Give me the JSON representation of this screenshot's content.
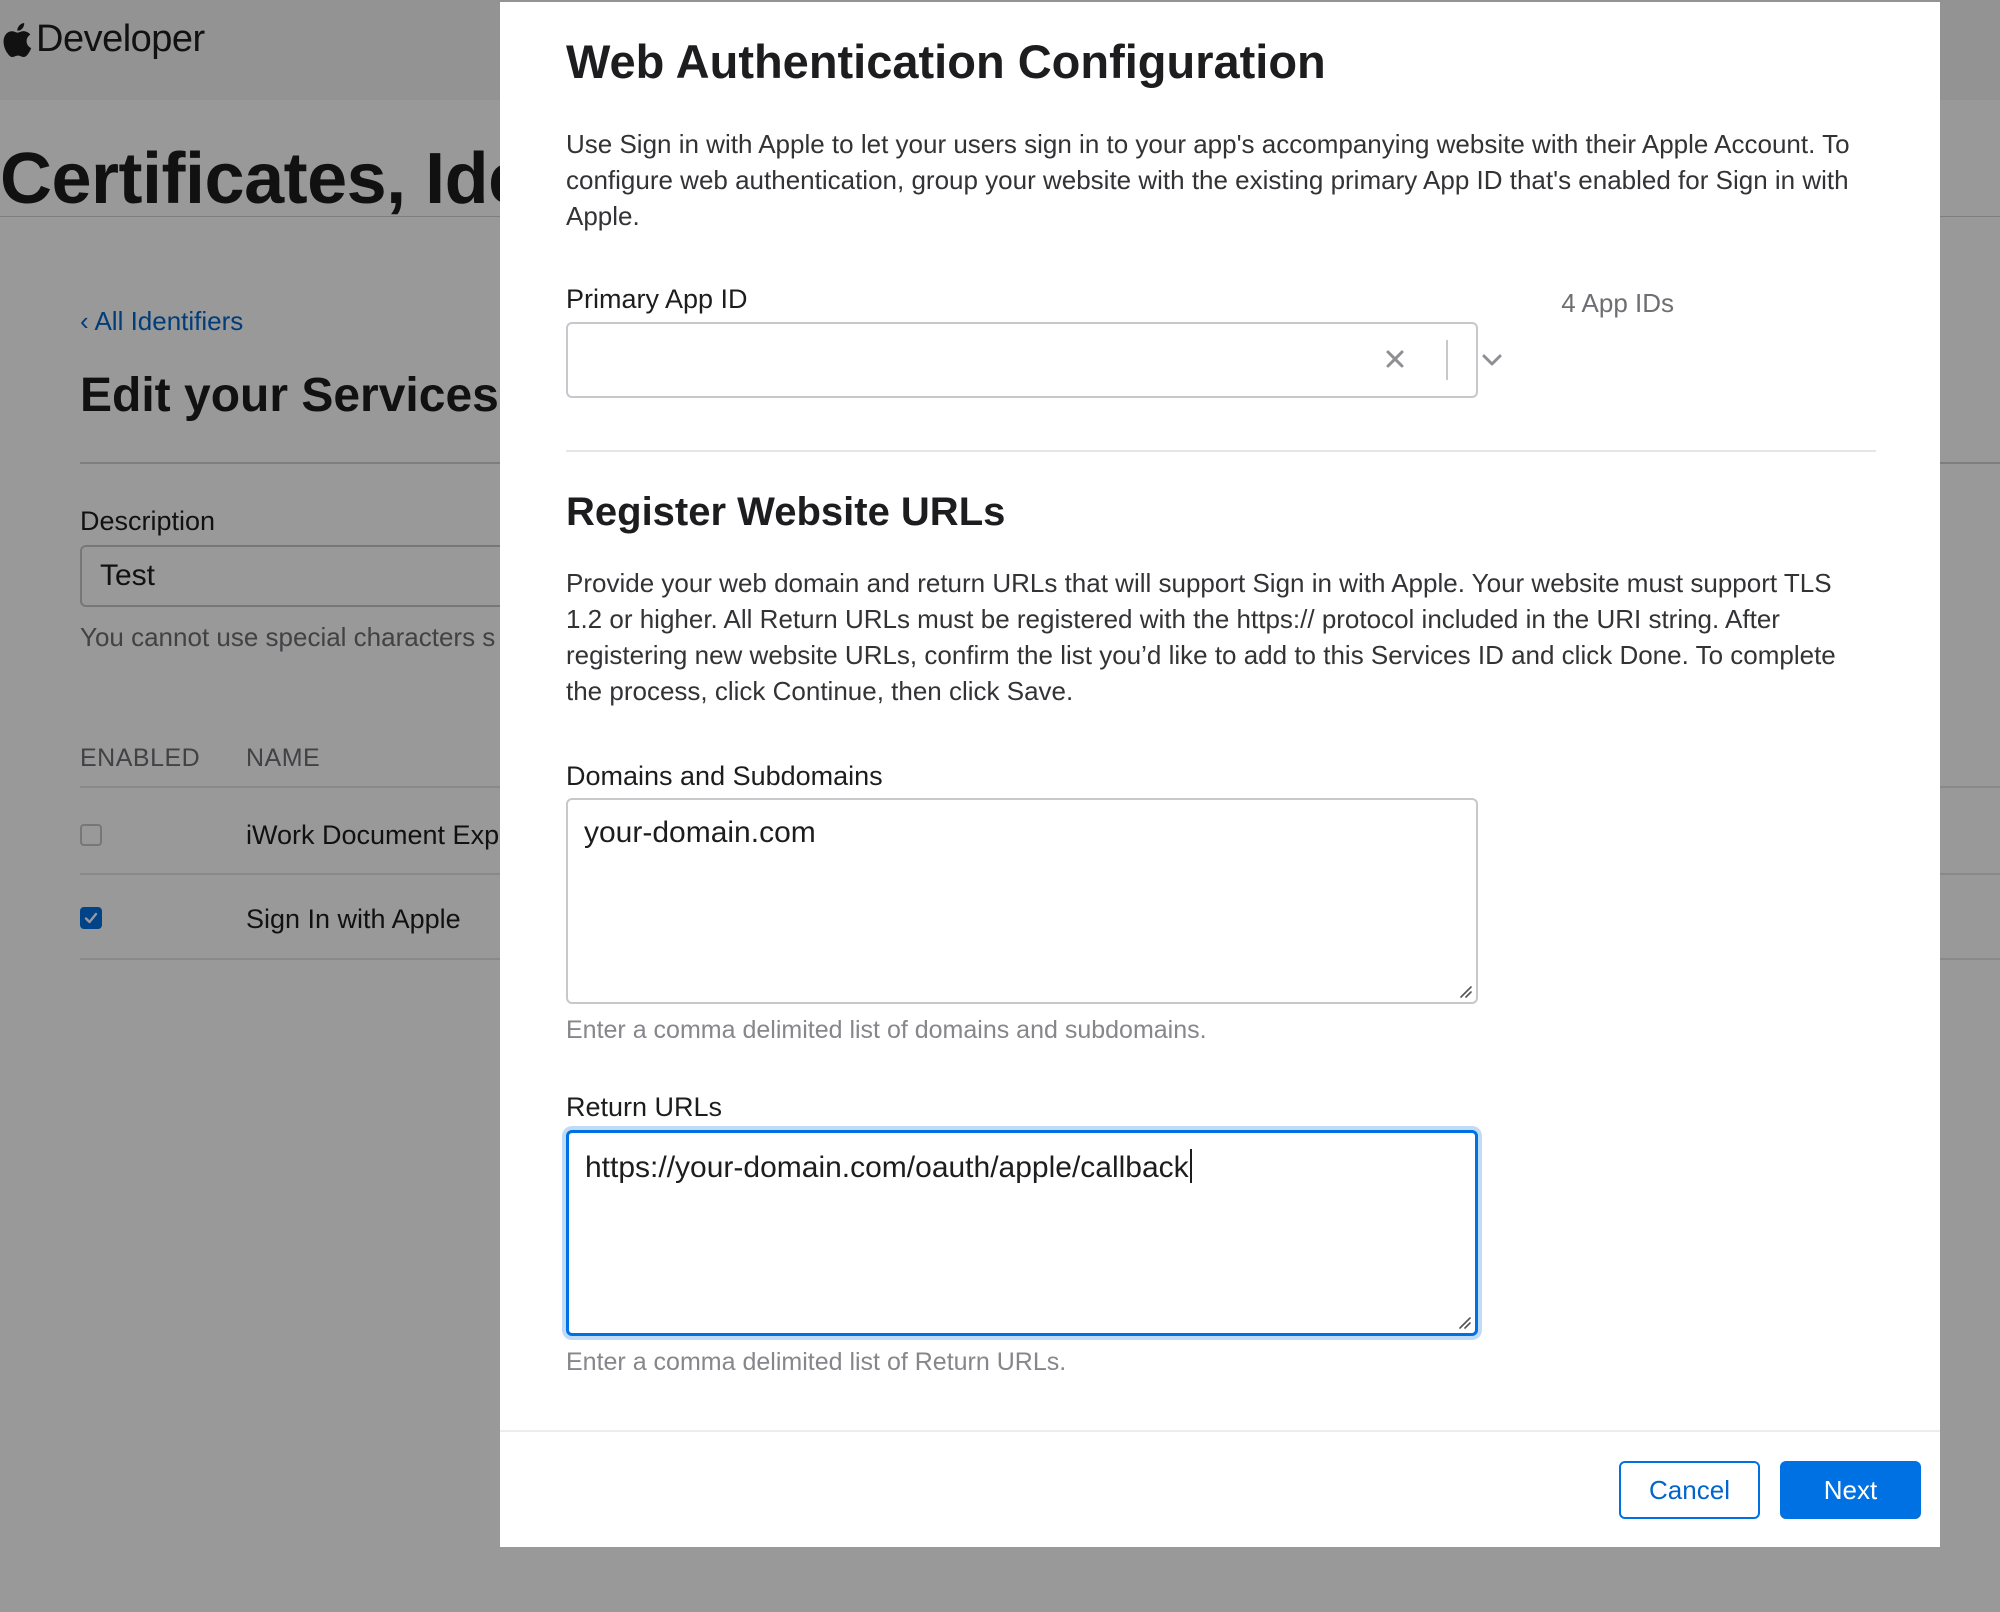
{
  "background": {
    "brand": "Developer",
    "hero_title": "Certificates, Ide",
    "back_link": "‹ All Identifiers",
    "edit_title": "Edit your Services",
    "description_label": "Description",
    "description_value": "Test",
    "description_help": "You cannot use special characters s",
    "table": {
      "headers": [
        "ENABLED",
        "NAME"
      ],
      "rows": [
        {
          "name": "iWork Document Exp",
          "checked": false
        },
        {
          "name": "Sign In with Apple",
          "checked": true
        }
      ]
    }
  },
  "modal": {
    "title": "Web Authentication Configuration",
    "intro": "Use Sign in with Apple to let your users sign in to your app's accompanying website with their Apple Account. To configure web authentication, group your website with the existing primary App ID that's enabled for Sign in with Apple.",
    "primary_app_id": {
      "label": "Primary App ID",
      "count": "4 App IDs",
      "value": "",
      "clear_icon": "close-icon",
      "dropdown_icon": "chevron-down-icon"
    },
    "register": {
      "title": "Register Website URLs",
      "text": "Provide your web domain and return URLs that will support Sign in with Apple. Your website must support TLS 1.2 or higher. All Return URLs must be registered with the https:// protocol included in the URI string. After registering new website URLs, confirm the list you’d like to add to this Services ID and click Done. To complete the process, click Continue, then click Save."
    },
    "domains": {
      "label": "Domains and Subdomains",
      "value": "your-domain.com",
      "help": "Enter a comma delimited list of domains and subdomains."
    },
    "return_urls": {
      "label": "Return URLs",
      "value": "https://your-domain.com/oauth/apple/callback",
      "help": "Enter a comma delimited list of Return URLs."
    },
    "buttons": {
      "cancel": "Cancel",
      "next": "Next"
    }
  },
  "colors": {
    "accent": "#0071e3",
    "link": "#0066cc",
    "overlay": "rgba(0,0,0,0.40)"
  }
}
